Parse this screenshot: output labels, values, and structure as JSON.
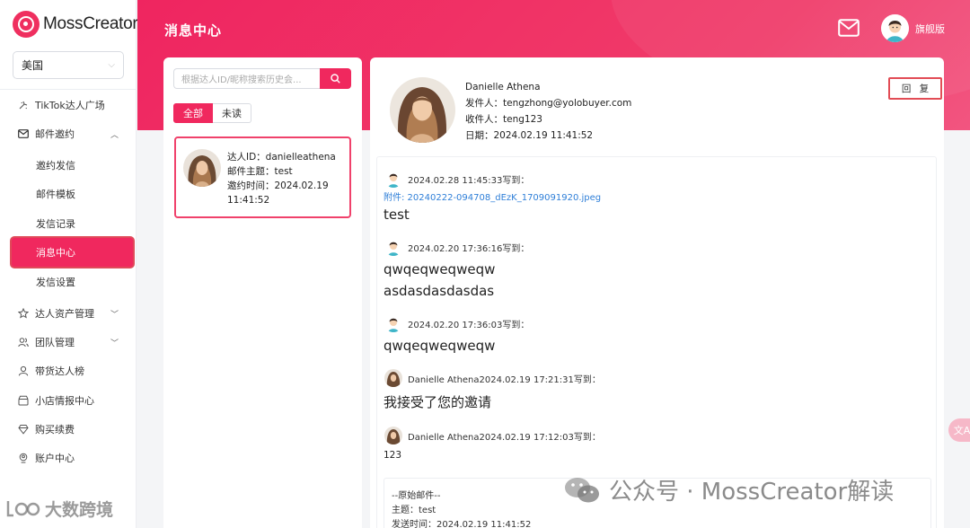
{
  "brand": {
    "name": "MossCreator",
    "accent": "#f0285e"
  },
  "sidebar": {
    "country": "美国",
    "items": [
      {
        "label": "TikTok达人广场",
        "icon": "sparkle-icon"
      },
      {
        "label": "邮件邀约",
        "icon": "mail-icon"
      },
      {
        "label": "达人资产管理",
        "icon": "star-icon"
      },
      {
        "label": "团队管理",
        "icon": "team-icon"
      },
      {
        "label": "带货达人榜",
        "icon": "user-icon"
      },
      {
        "label": "小店情报中心",
        "icon": "shop-icon"
      },
      {
        "label": "购买续费",
        "icon": "diamond-icon"
      },
      {
        "label": "账户中心",
        "icon": "account-icon"
      }
    ],
    "mail_sub": [
      "邀约发信",
      "邮件模板",
      "发信记录",
      "消息中心",
      "发信设置"
    ]
  },
  "header": {
    "title": "消息中心",
    "version": "旗舰版"
  },
  "list": {
    "search_placeholder": "根据达人ID/昵称搜索历史会...",
    "tabs": [
      "全部",
      "未读"
    ],
    "card": {
      "id_line": "达人ID：danielleathena",
      "subject_line": "邮件主题：test",
      "time_line": "邀约时间：2024.02.19",
      "time_line2": "11:41:52"
    }
  },
  "detail": {
    "name": "Danielle Athena",
    "sender": "发件人：tengzhong@yolobuyer.com",
    "recipient": "收件人：teng123",
    "date": "日期：2024.02.19 11:41:52",
    "reply_label": "回 复",
    "messages": [
      {
        "head": "2024.02.28 11:45:33写到：",
        "attachment": "附件: 20240222-094708_dEzK_1709091920.jpeg",
        "lines": [
          "test"
        ]
      },
      {
        "head": "2024.02.20 17:36:16写到：",
        "lines": [
          "qwqeqweqweqw",
          "asdasdasdasdas"
        ]
      },
      {
        "head": "2024.02.20 17:36:03写到：",
        "lines": [
          "qwqeqweqweqw"
        ]
      },
      {
        "head": "Danielle Athena2024.02.19 17:21:31写到：",
        "lines": [
          "我接受了您的邀请"
        ]
      },
      {
        "head": "Danielle Athena2024.02.19 17:12:03写到：",
        "lines": [
          "123"
        ]
      }
    ],
    "quote": {
      "title": "--原始邮件--",
      "subject": "主题：test",
      "sent": "发送时间：2024.02.19 11:41:52"
    }
  },
  "watermarks": {
    "left": "大数跨境",
    "right": "公众号 · MossCreator解读"
  }
}
